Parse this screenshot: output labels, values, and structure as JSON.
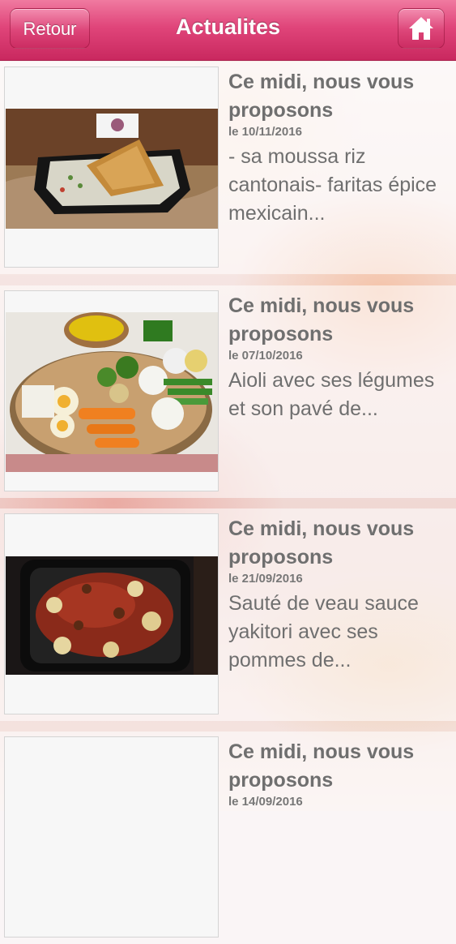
{
  "header": {
    "title": "Actualites",
    "back_label": "Retour",
    "home_icon": "home-icon",
    "color": "#d93a70"
  },
  "news": [
    {
      "title": "Ce midi, nous vous proposons",
      "date": "le 10/11/2016",
      "excerpt": "- sa moussa riz cantonais- faritas épice mexicain...",
      "image": "dish-rice-samosa-photo"
    },
    {
      "title": "Ce midi, nous vous proposons",
      "date": "le 07/10/2016",
      "excerpt": "Aioli avec ses légumes et son pavé de...",
      "image": "aioli-vegetable-platter-photo"
    },
    {
      "title": "Ce midi, nous vous proposons",
      "date": "le 21/09/2016",
      "excerpt": "Sauté de veau sauce yakitori avec ses pommes de...",
      "image": "veal-saute-photo"
    },
    {
      "title": "Ce midi, nous vous proposons",
      "date": "le 14/09/2016",
      "excerpt": "",
      "image": "placeholder-photo"
    }
  ]
}
